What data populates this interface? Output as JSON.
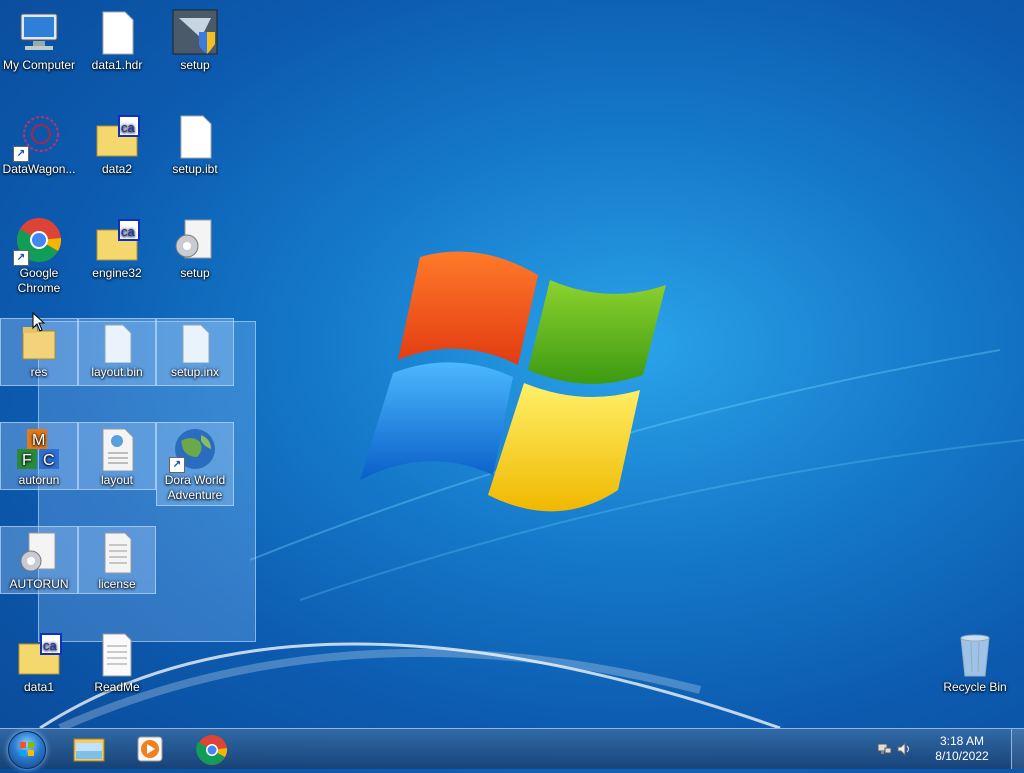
{
  "desktop": {
    "icons": [
      {
        "label": "My Computer",
        "icon": "computer-icon"
      },
      {
        "label": "data1.hdr",
        "icon": "file-icon"
      },
      {
        "label": "setup",
        "icon": "setup-shield-icon"
      },
      {
        "label": "DataWagon...",
        "icon": "datawagon-icon"
      },
      {
        "label": "data2",
        "icon": "cab-folder-icon"
      },
      {
        "label": "setup.ibt",
        "icon": "file-icon"
      },
      {
        "label": "Google Chrome",
        "icon": "chrome-icon"
      },
      {
        "label": "engine32",
        "icon": "cab-folder-icon"
      },
      {
        "label": "setup",
        "icon": "settings-file-icon"
      },
      {
        "label": "res",
        "icon": "folder-icon"
      },
      {
        "label": "layout.bin",
        "icon": "file-icon"
      },
      {
        "label": "setup.inx",
        "icon": "file-icon"
      },
      {
        "label": "autorun",
        "icon": "autorun-mfc-icon"
      },
      {
        "label": "layout",
        "icon": "document-icon"
      },
      {
        "label": "Dora World Adventure",
        "icon": "globe-icon"
      },
      {
        "label": "AUTORUN",
        "icon": "settings-file-icon"
      },
      {
        "label": "license",
        "icon": "text-file-icon"
      },
      {
        "label": "data1",
        "icon": "cab-folder-icon"
      },
      {
        "label": "ReadMe",
        "icon": "text-file-icon"
      },
      {
        "label": "Recycle Bin",
        "icon": "recycle-bin-icon"
      }
    ]
  },
  "taskbar": {
    "pinned": [
      {
        "name": "Windows Explorer",
        "icon": "explorer-icon"
      },
      {
        "name": "Windows Media Player",
        "icon": "media-player-icon"
      },
      {
        "name": "Google Chrome",
        "icon": "chrome-icon"
      }
    ],
    "clock": {
      "time": "3:18 AM",
      "date": "8/10/2022"
    }
  },
  "colors": {
    "accent": "#1579c9",
    "taskbar": "#2a5585"
  }
}
